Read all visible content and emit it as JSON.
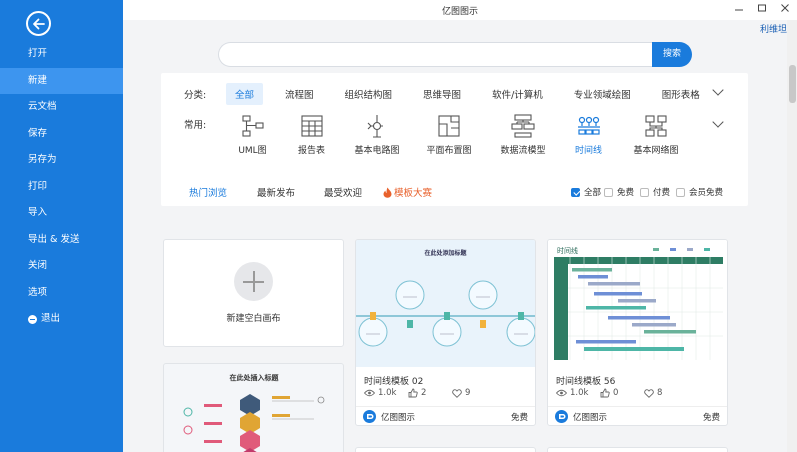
{
  "window": {
    "title": "亿图图示",
    "user": "利维坦"
  },
  "sidebar": {
    "items": [
      {
        "label": "打开"
      },
      {
        "label": "新建"
      },
      {
        "label": "云文档"
      },
      {
        "label": "保存"
      },
      {
        "label": "另存为"
      },
      {
        "label": "打印"
      },
      {
        "label": "导入"
      },
      {
        "label": "导出 & 发送"
      },
      {
        "label": "关闭"
      },
      {
        "label": "选项"
      },
      {
        "label": "退出"
      }
    ],
    "active_index": 1
  },
  "search": {
    "placeholder": "",
    "button": "搜索"
  },
  "categories": {
    "label": "分类:",
    "tabs": [
      "全部",
      "流程图",
      "组织结构图",
      "思维导图",
      "软件/计算机",
      "专业领域绘图",
      "图形表格"
    ],
    "active": "全部"
  },
  "common": {
    "label": "常用:",
    "items": [
      {
        "label": "UML图",
        "icon": "uml-icon"
      },
      {
        "label": "报告表",
        "icon": "report-icon"
      },
      {
        "label": "基本电路图",
        "icon": "circuit-icon"
      },
      {
        "label": "平面布置图",
        "icon": "floorplan-icon"
      },
      {
        "label": "数据流模型",
        "icon": "dataflow-icon"
      },
      {
        "label": "时间线",
        "icon": "timeline-icon"
      },
      {
        "label": "基本网络图",
        "icon": "network-icon"
      }
    ],
    "active": "时间线"
  },
  "filters": {
    "tabs": [
      "热门浏览",
      "最新发布",
      "最受欢迎",
      "模板大赛"
    ],
    "active": "热门浏览",
    "checks": [
      {
        "label": "全部",
        "checked": true
      },
      {
        "label": "免费",
        "checked": false
      },
      {
        "label": "付费",
        "checked": false
      },
      {
        "label": "会员免费",
        "checked": false
      }
    ]
  },
  "new_blank": {
    "label": "新建空白画布"
  },
  "templates": [
    {
      "name": "时间线模板 02",
      "views": "1.0k",
      "likes": "2",
      "favs": "9",
      "brand": "亿图图示",
      "price": "免费",
      "thumb_title": "在此处添加标题"
    },
    {
      "name": "时间线模板 56",
      "views": "1.0k",
      "likes": "0",
      "favs": "8",
      "brand": "亿图图示",
      "price": "免费",
      "thumb_title": "时间线"
    }
  ],
  "partial_card": {
    "thumb_title": "在此处插入标题"
  },
  "colors": {
    "sidebar": "#1a7bdc",
    "accent": "#1a7bdc",
    "hot": "#e8612c"
  }
}
